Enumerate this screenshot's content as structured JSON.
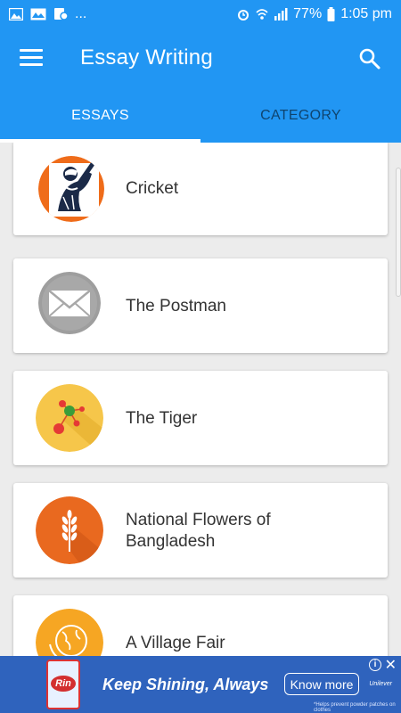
{
  "status_bar": {
    "battery": "77%",
    "time": "1:05 pm",
    "dots": "..."
  },
  "app_bar": {
    "title": "Essay Writing"
  },
  "tabs": [
    {
      "label": "ESSAYS",
      "selected": true
    },
    {
      "label": "CATEGORY",
      "selected": false
    }
  ],
  "essays": [
    {
      "title": "Cricket",
      "icon": "cricket-player-icon"
    },
    {
      "title": "The Postman",
      "icon": "envelope-icon"
    },
    {
      "title": "The Tiger",
      "icon": "molecule-icon"
    },
    {
      "title": "National Flowers of Bangladesh",
      "icon": "wheat-icon"
    },
    {
      "title": "A Village Fair",
      "icon": "globe-icon"
    }
  ],
  "ad": {
    "tagline": "Keep Shining, Always",
    "cta": "Know more",
    "product": "Rin",
    "fine_print": "*Helps prevent powder patches on clothes",
    "brand": "Unilever"
  },
  "colors": {
    "primary": "#2196f3",
    "ad_background": "#2f63bd"
  }
}
